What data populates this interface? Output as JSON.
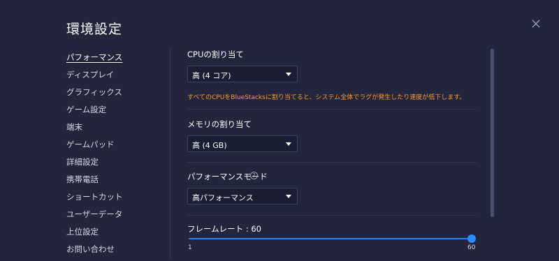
{
  "window": {
    "title": "環境設定"
  },
  "sidebar": {
    "items": [
      {
        "label": "パフォーマンス",
        "active": true
      },
      {
        "label": "ディスプレイ"
      },
      {
        "label": "グラフィックス"
      },
      {
        "label": "ゲーム設定"
      },
      {
        "label": "端末"
      },
      {
        "label": "ゲームパッド"
      },
      {
        "label": "詳細設定"
      },
      {
        "label": "携帯電話"
      },
      {
        "label": "ショートカット"
      },
      {
        "label": "ユーザーデータ"
      },
      {
        "label": "上位設定"
      },
      {
        "label": "お問い合わせ"
      }
    ]
  },
  "cpu": {
    "label": "CPUの割り当て",
    "value": "高 (4 コア)",
    "warning": "すべてのCPUをBlueStacksに割り当てると、システム全体でラグが発生したり速度が低下します。"
  },
  "memory": {
    "label": "メモリの割り当て",
    "value": "高 (4 GB)"
  },
  "performance_mode": {
    "label": "パフォーマンスモード",
    "help_glyph": "?",
    "value": "高パフォーマンス"
  },
  "frame_rate": {
    "label": "フレームレート : 60",
    "min": "1",
    "max": "60",
    "value": 60
  },
  "colors": {
    "accent": "#2b8cff",
    "warning": "#ff9b2e",
    "background": "#22253c"
  },
  "icons": {
    "close": "close-icon",
    "dropdown": "chevron-down-icon",
    "help": "help-icon"
  }
}
